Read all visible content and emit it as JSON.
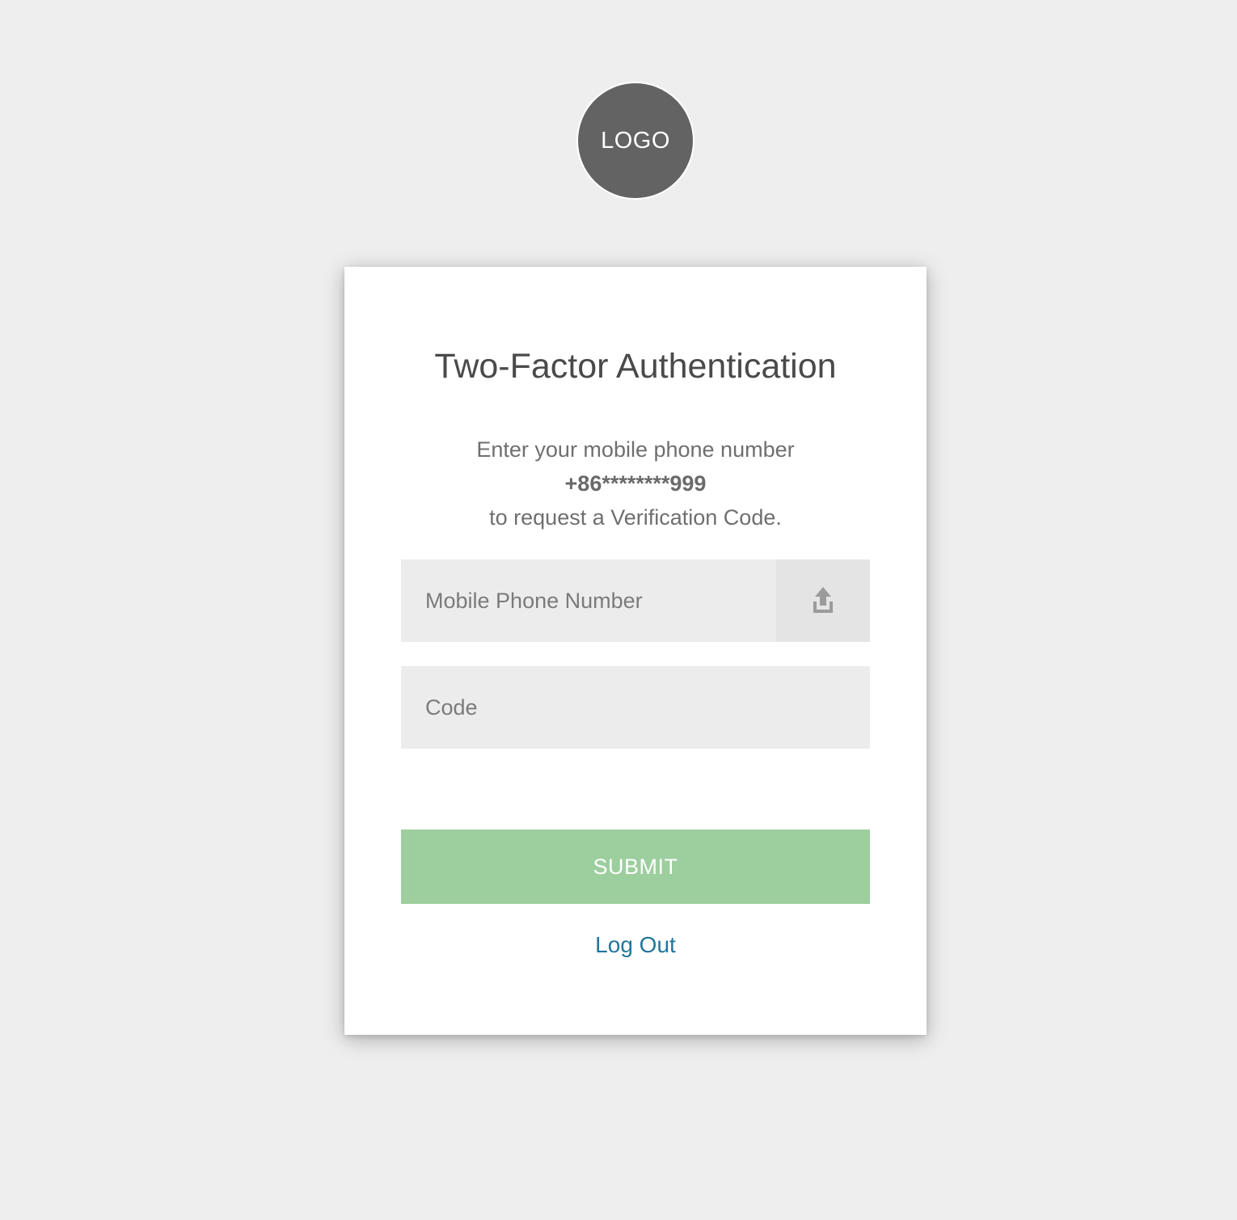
{
  "logo": {
    "text": "LOGO"
  },
  "card": {
    "title": "Two-Factor Authentication",
    "instructions": {
      "line1": "Enter your mobile phone number",
      "phone": "+86********999",
      "line3": "to request a Verification Code."
    },
    "phone_input": {
      "placeholder": "Mobile Phone Number",
      "value": "",
      "send_icon": "send-code-icon"
    },
    "code_input": {
      "placeholder": "Code",
      "value": ""
    },
    "submit_label": "SUBMIT",
    "logout_label": "Log Out"
  },
  "colors": {
    "background": "#eeeeee",
    "logo_bg": "#636363",
    "submit_bg": "#9dce9e",
    "link": "#21769b",
    "input_bg": "#ececec"
  }
}
